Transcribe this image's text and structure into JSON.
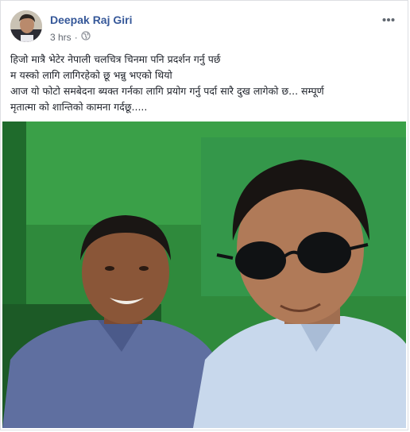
{
  "post": {
    "author_name": "Deepak Raj Giri",
    "timestamp": "3 hrs",
    "separator": "·",
    "audience_icon": "globe-icon",
    "more_icon": "more-horizontal-icon",
    "text_lines": [
      "हिजो मात्रै भेटेर नेपाली चलचित्र चिनमा पनि प्रदर्शन गर्नु पर्छ",
      "म यस्को लागि लागिरहेको छू भन्नु भएको थियो",
      "आज यो फोटो समबेदना ब्यक्त गर्नका लागि प्रयोग गर्नु पर्दा सारै दुख लागेको छ... सम्पूर्ण",
      "मृतात्मा को शान्तिको कामना गर्दछू....."
    ]
  },
  "colors": {
    "author_link": "#365899",
    "meta_text": "#616770",
    "body_text": "#1d2129",
    "photo_background_green": "#2f8a3c"
  }
}
